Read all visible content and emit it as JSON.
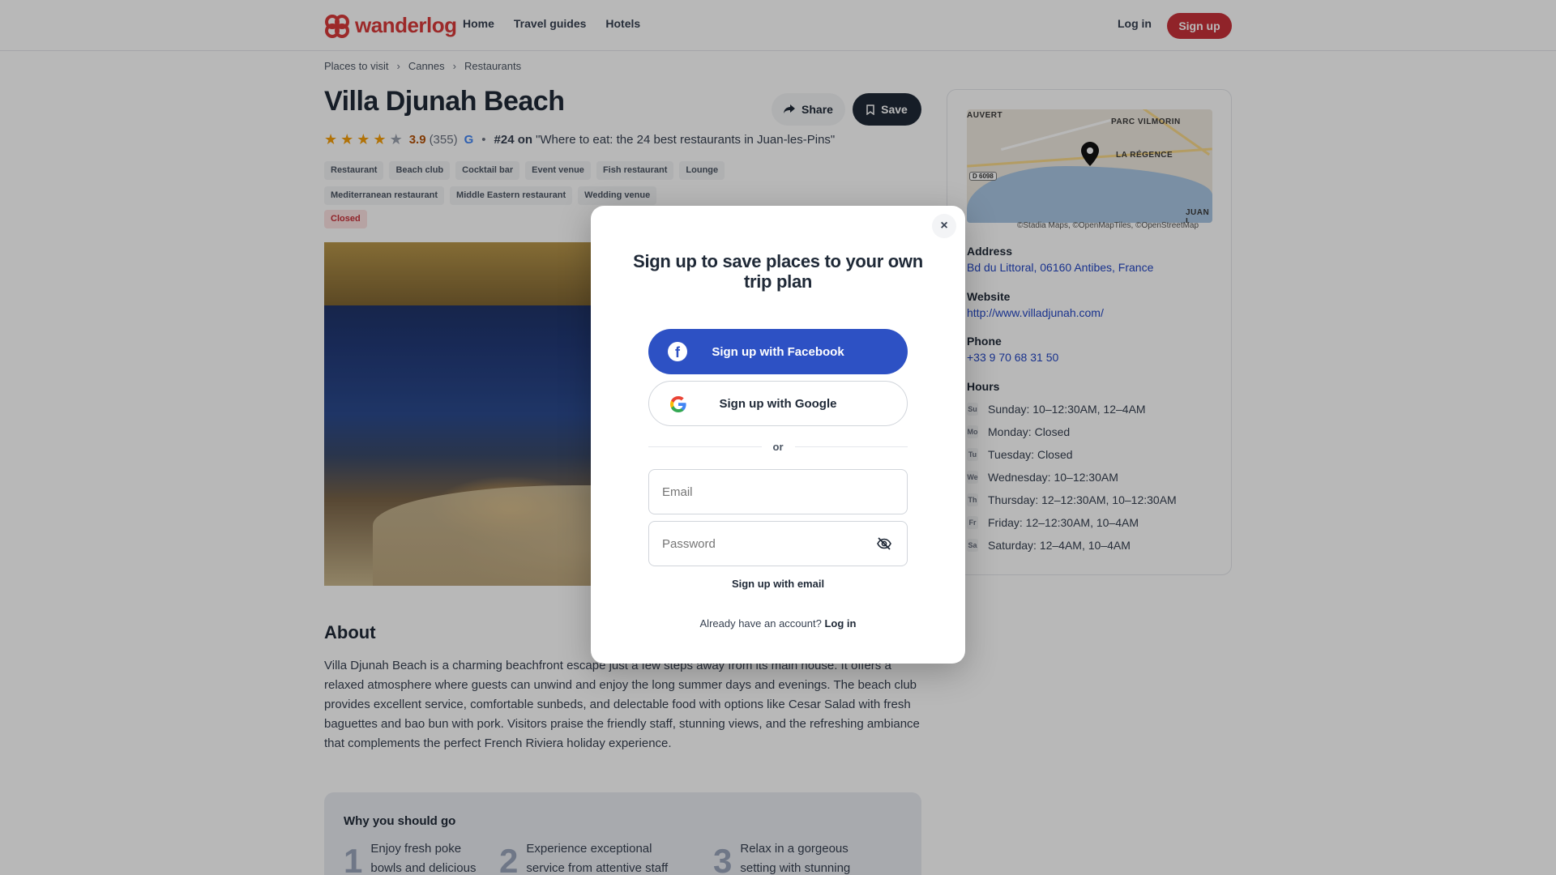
{
  "header": {
    "logo_text": "wanderlog",
    "nav": [
      "Home",
      "Travel guides",
      "Hotels"
    ],
    "login": "Log in",
    "signup": "Sign up",
    "brand_color": "#d93a3a"
  },
  "breadcrumb": [
    "Places to visit",
    "Cannes",
    "Restaurants"
  ],
  "place": {
    "title": "Villa Djunah Beach",
    "share": "Share",
    "save": "Save",
    "rating": "3.9",
    "rating_count": "(355)",
    "rank_prefix": "#24 on",
    "rank_list": "\"Where to eat: the 24 best restaurants in Juan-les-Pins\"",
    "tags": [
      "Restaurant",
      "Beach club",
      "Cocktail bar",
      "Event venue",
      "Fish restaurant",
      "Lounge",
      "Mediterranean restaurant",
      "Middle Eastern restaurant",
      "Wedding venue"
    ],
    "status": "Closed"
  },
  "about": {
    "title": "About",
    "text": "Villa Djunah Beach is a charming beachfront escape just a few steps away from its main house. It offers a relaxed atmosphere where guests can unwind and enjoy the long summer days and evenings. The beach club provides excellent service, comfortable sunbeds, and delectable food with options like Cesar Salad with fresh baguettes and bao bun with pork. Visitors praise the friendly staff, stunning views, and the refreshing ambiance that complements the perfect French Riviera holiday experience."
  },
  "why": {
    "title": "Why you should go",
    "items": [
      {
        "num": "1",
        "text": "Enjoy fresh poke bowls and delicious"
      },
      {
        "num": "2",
        "text": "Experience exceptional service from attentive staff members"
      },
      {
        "num": "3",
        "text": "Relax in a gorgeous setting with stunning waterfront"
      }
    ]
  },
  "map": {
    "labels": {
      "auvert": "AUVERT",
      "parc": "PARC VILMORIN",
      "regence": "LA RÉGENCE",
      "juan": "JUAN L"
    },
    "road": "D 6098",
    "credit": "©Stadia Maps, ©OpenMapTiles, ©OpenStreetMap"
  },
  "info": {
    "address_label": "Address",
    "address": "Bd du Littoral, 06160 Antibes, France",
    "website_label": "Website",
    "website": "http://www.villadjunah.com/",
    "phone_label": "Phone",
    "phone": "+33 9 70 68 31 50",
    "hours_label": "Hours",
    "hours": [
      {
        "day": "Su",
        "text": "Sunday: 10–12:30AM, 12–4AM"
      },
      {
        "day": "Mo",
        "text": "Monday: Closed"
      },
      {
        "day": "Tu",
        "text": "Tuesday: Closed"
      },
      {
        "day": "We",
        "text": "Wednesday: 10–12:30AM"
      },
      {
        "day": "Th",
        "text": "Thursday: 12–12:30AM, 10–12:30AM"
      },
      {
        "day": "Fr",
        "text": "Friday: 12–12:30AM, 10–4AM"
      },
      {
        "day": "Sa",
        "text": "Saturday: 12–4AM, 10–4AM"
      }
    ]
  },
  "modal": {
    "title": "Sign up to save places to your own trip plan",
    "close": "×",
    "facebook": "Sign up with Facebook",
    "google": "Sign up with Google",
    "or": "or",
    "email_placeholder": "Email",
    "password_placeholder": "Password",
    "email_signup": "Sign up with email",
    "have_account": "Already have an account?",
    "login": "Log in",
    "facebook_color": "#2d51c4"
  }
}
